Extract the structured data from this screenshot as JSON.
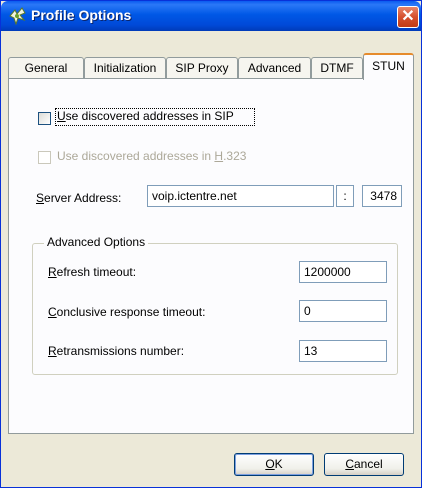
{
  "window": {
    "title": "Profile Options",
    "close_glyph": "✕"
  },
  "tabs": [
    {
      "label": "General",
      "active": false
    },
    {
      "label": "Initialization",
      "active": false
    },
    {
      "label": "SIP Proxy",
      "active": false
    },
    {
      "label": "Advanced",
      "active": false
    },
    {
      "label": "DTMF",
      "active": false
    },
    {
      "label": "STUN",
      "active": true
    }
  ],
  "stun": {
    "use_sip": {
      "label_hotkey": "U",
      "label_rest": "se discovered addresses in SIP",
      "checked": false,
      "enabled": true
    },
    "use_h323": {
      "label_pre": "Use discovered addresses in ",
      "label_hotkey": "H",
      "label_post": ".323",
      "checked": false,
      "enabled": false
    },
    "server": {
      "label_hotkey": "S",
      "label_rest": "erver Address:",
      "address": "voip.ictentre.net",
      "separator": ":",
      "port": "3478"
    },
    "advanced": {
      "title": "Advanced Options",
      "refresh": {
        "label_hotkey": "R",
        "label_rest": "efresh timeout:",
        "value": "1200000"
      },
      "conclusive": {
        "label_hotkey": "C",
        "label_rest": "onclusive response timeout:",
        "value": "0"
      },
      "retrans": {
        "label_hotkey": "R",
        "label_rest": "etransmissions number:",
        "value": "13"
      }
    }
  },
  "buttons": {
    "ok": {
      "hotkey": "O",
      "rest": "K"
    },
    "cancel": {
      "hotkey": "C",
      "rest": "ancel"
    }
  },
  "colors": {
    "titlebar": "#0058e6",
    "dialog_bg": "#ece9d8",
    "active_tab_accent": "#e68b2c",
    "close_button": "#d5512f"
  },
  "icons": [
    "app-icon",
    "close-icon"
  ]
}
